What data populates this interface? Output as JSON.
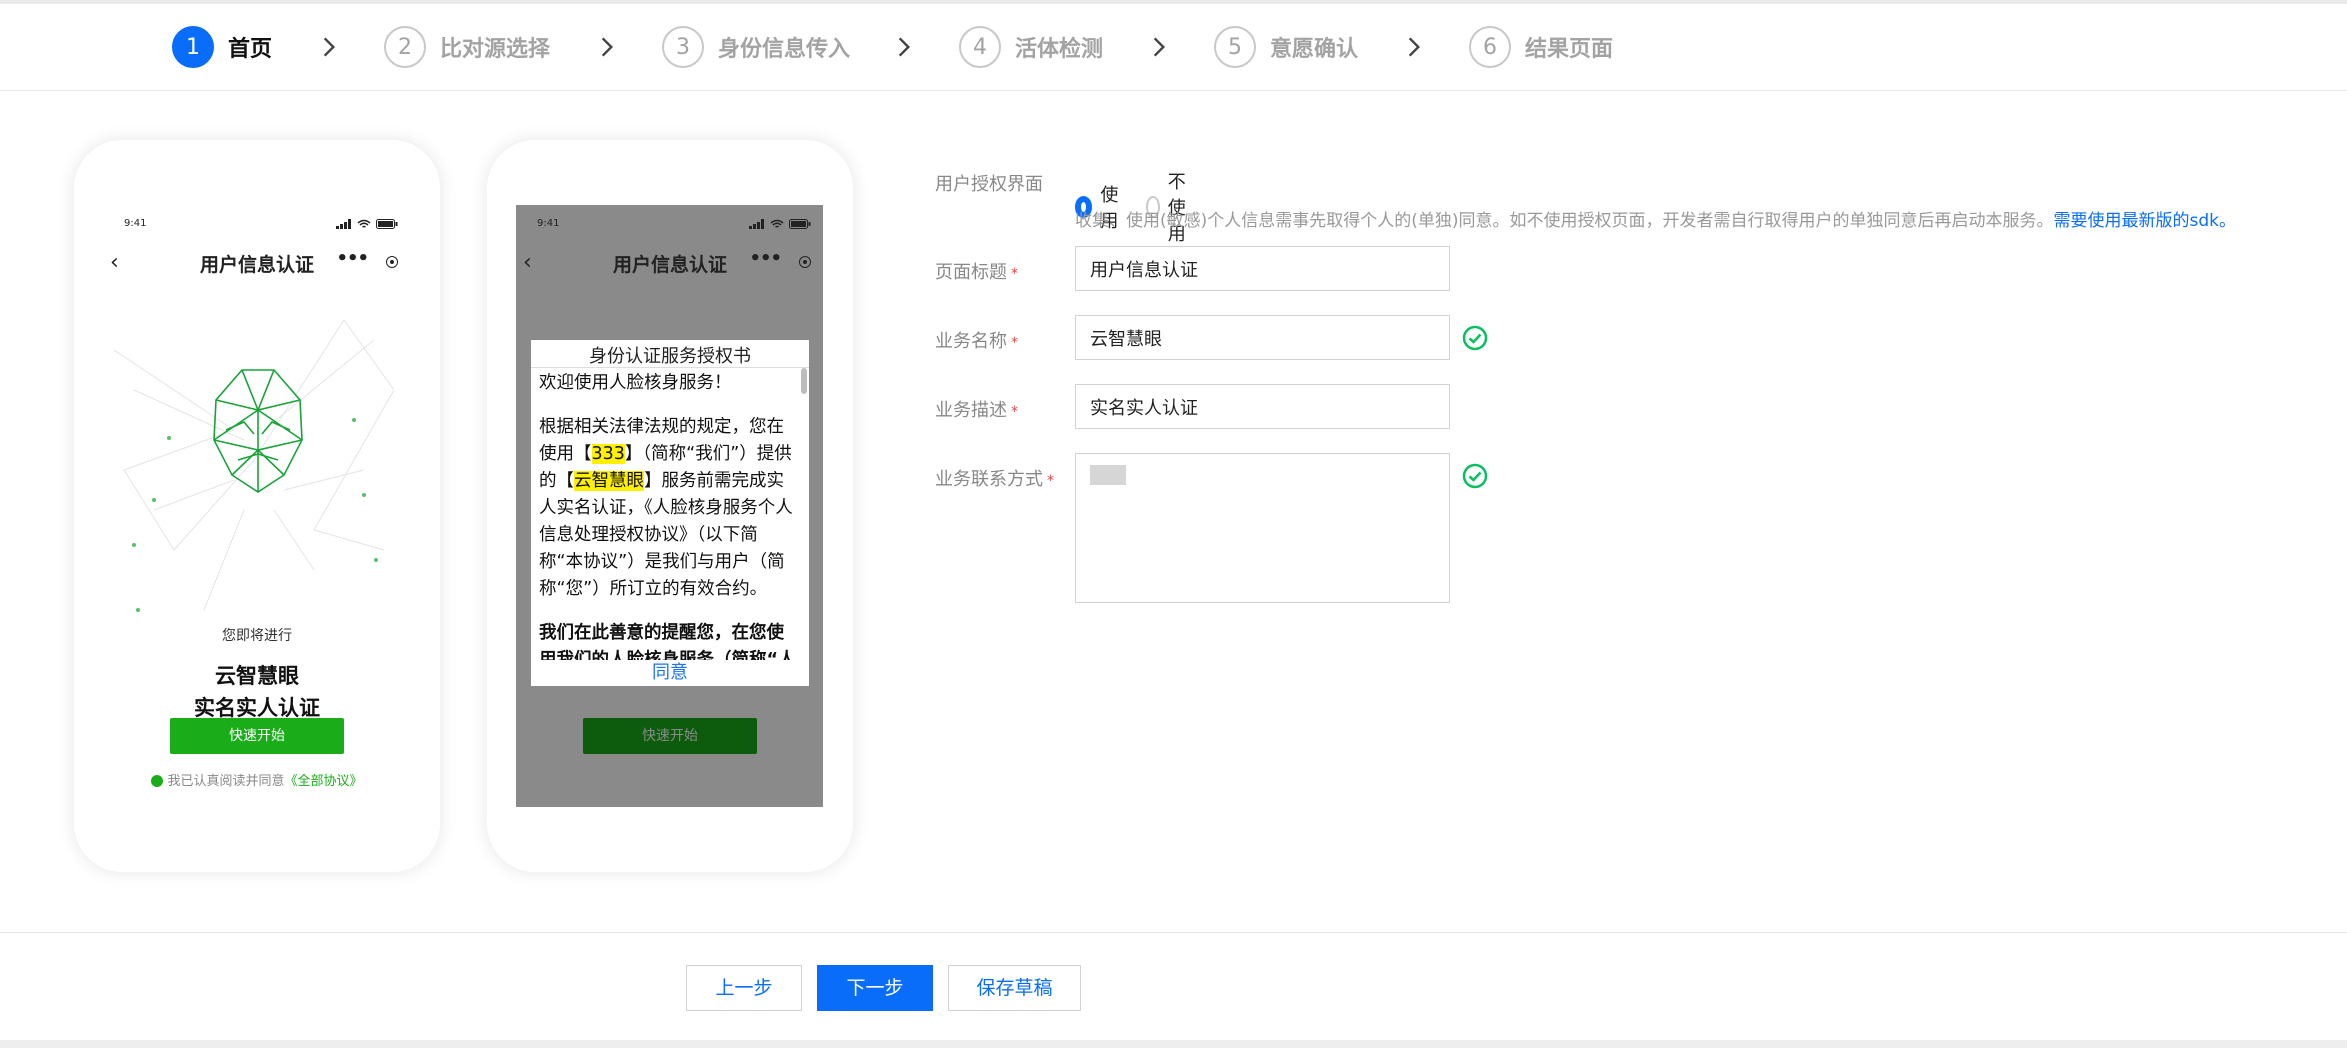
{
  "steps": [
    {
      "num": "1",
      "label": "首页",
      "active": true
    },
    {
      "num": "2",
      "label": "比对源选择"
    },
    {
      "num": "3",
      "label": "身份信息传入"
    },
    {
      "num": "4",
      "label": "活体检测"
    },
    {
      "num": "5",
      "label": "意愿确认"
    },
    {
      "num": "6",
      "label": "结果页面"
    }
  ],
  "phone1": {
    "time": "9:41",
    "nav_title": "用户信息认证",
    "intro": "您即将进行",
    "title_line1": "云智慧眼",
    "title_line2": "实名实人认证",
    "agree_text": "我已认真阅读并同意",
    "agree_link": "《全部协议》",
    "start_label": "快速开始"
  },
  "phone2": {
    "time": "9:41",
    "nav_title": "用户信息认证",
    "start_label": "快速开始",
    "dialog": {
      "title": "身份认证服务授权书",
      "welcome": "欢迎使用人脸核身服务！",
      "p1_a": "根据相关法律法规的规定，您在使用【",
      "p1_company": "333",
      "p1_b": "】（简称“我们”）提供的【",
      "p1_service": "云智慧眼",
      "p1_c": "】服务前需完成实人实名认证，《人脸核身服务个人信息处理授权协议》（以下简称“本协议”）是我们与用户（简称“您”）所订立的有效合约。",
      "p2": "我们在此善意的提醒您，在您使用我们的人脸核身服务（简称“人",
      "agree_btn": "同意"
    }
  },
  "form": {
    "auth_label": "用户授权界面",
    "opt_use": "使用",
    "opt_nouse": "不使用",
    "hint_text": "收集、使用(敏感)个人信息需事先取得个人的(单独)同意。如不使用授权页面，开发者需自行取得用户的单独同意后再启动本服务。",
    "hint_link": "需要使用最新版的sdk。",
    "page_title_label": "页面标题",
    "page_title_value": "用户信息认证",
    "biz_name_label": "业务名称",
    "biz_name_value": "云智慧眼",
    "biz_desc_label": "业务描述",
    "biz_desc_value": "实名实人认证",
    "biz_contact_label": "业务联系方式",
    "req": "*"
  },
  "footer": {
    "prev": "上一步",
    "next": "下一步",
    "save": "保存草稿"
  },
  "colors": {
    "primary": "#0a6dfa",
    "green": "#1aad19",
    "success": "#07c160"
  }
}
